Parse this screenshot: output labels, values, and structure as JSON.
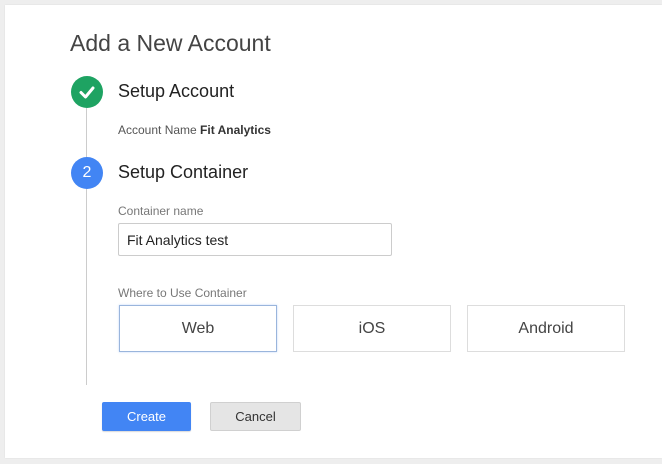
{
  "page": {
    "title": "Add a New Account"
  },
  "steps": [
    {
      "title": "Setup Account",
      "state": "complete",
      "icon": "check-icon",
      "account_name_label": "Account Name",
      "account_name_value": "Fit Analytics"
    },
    {
      "number": "2",
      "title": "Setup Container",
      "state": "active"
    }
  ],
  "container": {
    "name_label": "Container name",
    "name_value": "Fit Analytics test",
    "where_label": "Where to Use Container",
    "options": [
      "Web",
      "iOS",
      "Android"
    ],
    "selected": "Web"
  },
  "actions": {
    "create_label": "Create",
    "cancel_label": "Cancel"
  },
  "colors": {
    "complete": "#1ea362",
    "active": "#4285f4",
    "primary_button": "#4285f4"
  }
}
